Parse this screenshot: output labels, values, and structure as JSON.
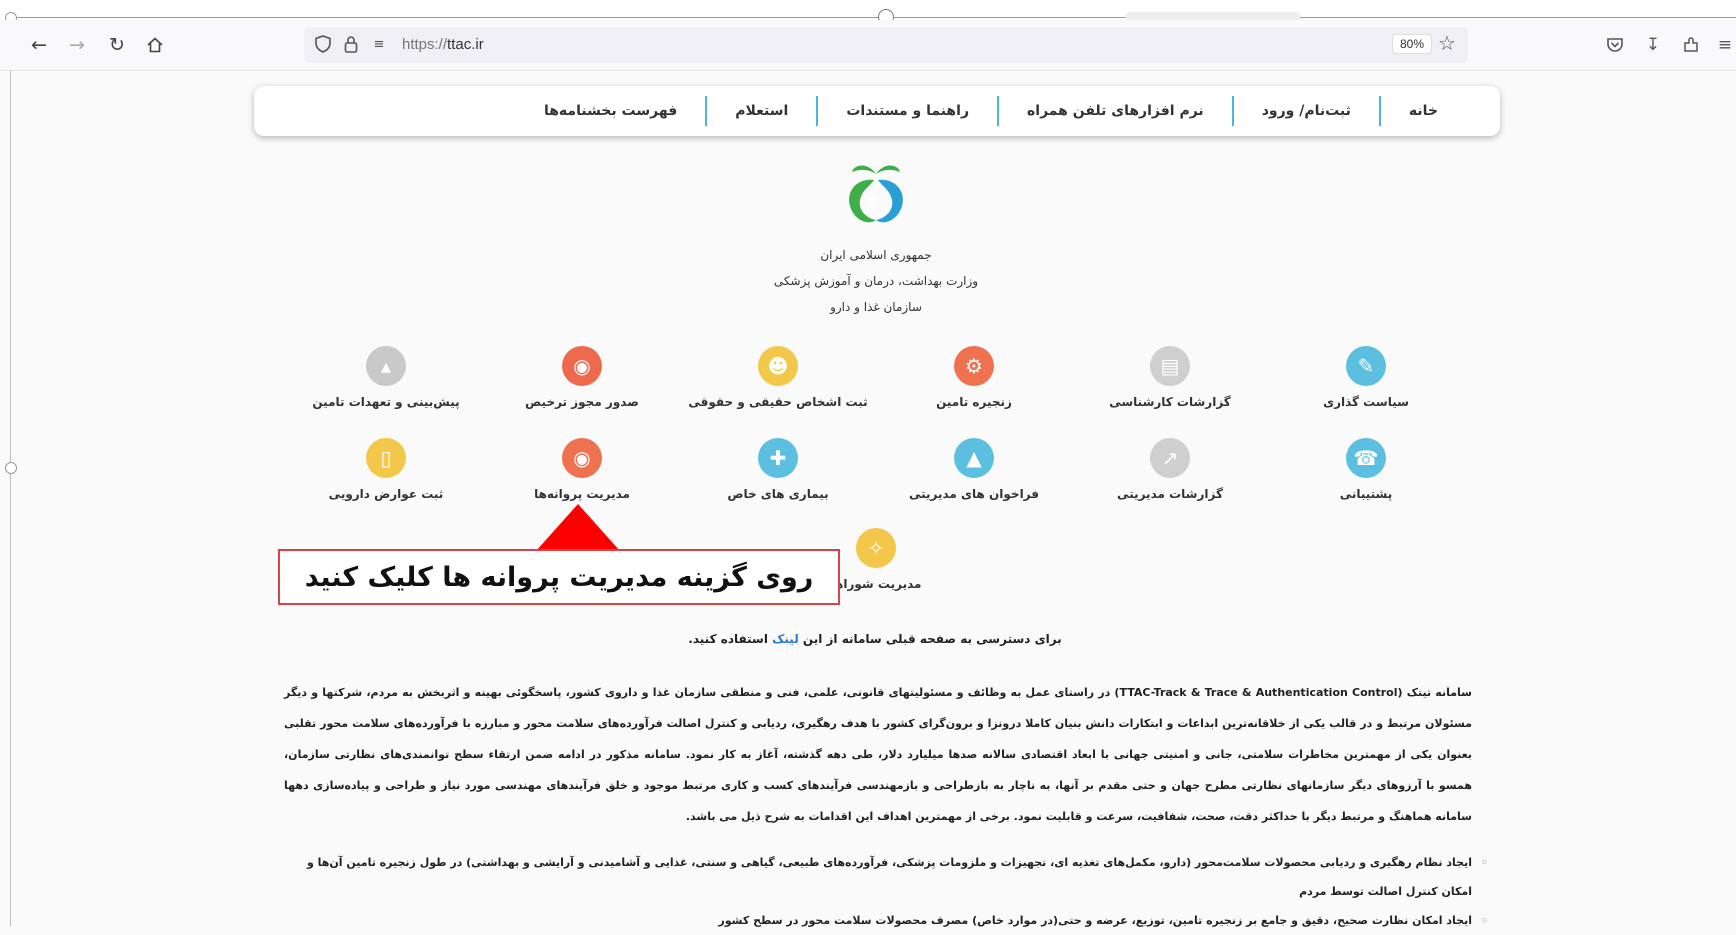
{
  "browser": {
    "url_scheme": "https://",
    "url_host": "ttac.ir",
    "zoom": "80%"
  },
  "nav": [
    "خانه",
    "ثبت‌نام/ ورود",
    "نرم افزارهای تلفن همراه",
    "راهنما و مستندات",
    "استعلام",
    "فهرست بخشنامه‌ها"
  ],
  "ministry": {
    "line1": "جمهوری اسلامی ایران",
    "line2": "وزارت بهداشت، درمان و آموزش پزشکی",
    "line3": "سازمان غذا و دارو"
  },
  "services": [
    {
      "label": "سیاست گذاری",
      "icon": "policy-document-icon",
      "color": "#5cbfe0"
    },
    {
      "label": "گزارشات کارشناسی",
      "icon": "expert-report-icon",
      "color": "#cfcfcf"
    },
    {
      "label": "زنجیره تامین",
      "icon": "supply-chain-icon",
      "color": "#ee7150"
    },
    {
      "label": "ثبت اشخاص حقیقی و حقوقی",
      "icon": "people-registration-icon",
      "color": "#f3c74a"
    },
    {
      "label": "صدور مجوز ترخیص",
      "icon": "clearance-globe-icon",
      "color": "#ee6a4f"
    },
    {
      "label": "پیش‌بینی و تعهدات تامین",
      "icon": "forecast-chart-icon",
      "color": "#c9c9c9"
    },
    {
      "label": "پشتیبانی",
      "icon": "support-icon",
      "color": "#5cbfe0"
    },
    {
      "label": "گزارشات مدیریتی",
      "icon": "management-report-icon",
      "color": "#cfcfcf"
    },
    {
      "label": "فراخوان های مدیریتی",
      "icon": "management-call-icon",
      "color": "#5cbfe0"
    },
    {
      "label": "بیماری های خاص",
      "icon": "special-disease-icon",
      "color": "#5cbfe0"
    },
    {
      "label": "مدیریت پروانه‌ها",
      "icon": "license-management-icon",
      "color": "#ee7150"
    },
    {
      "label": "ثبت عوارض دارویی",
      "icon": "drug-side-effects-icon",
      "color": "#f3c74a"
    },
    {
      "label": "مدیریت شوراها",
      "icon": "councils-management-icon",
      "color": "#f3c74a"
    }
  ],
  "callout": "روی گزینه مدیریت پروانه ها کلیک کنید",
  "access": {
    "before": "برای دسترسی به صفحه قبلی سامانه از این ",
    "link": "لینک",
    "after": " استفاده کنید."
  },
  "description": "سامانه تیتک (TTAC-Track & Trace & Authentication Control) در راستای عمل به وظائف و مسئولیتهای قانونی، علمی، فنی و منطقی سازمان غذا و داروی کشور، پاسخگوئی بهینه و اثربخش به مردم، شرکتها و دیگر مسئولان مرتبط و در قالب یکی از خلاقانه‌ترین ابداعات و ابتکارات دانش بنیان کاملا درونزا و برون‌گرای کشور با هدف رهگیری، ردیابی و کنترل اصالت فرآورده‌های سلامت محور و مبارزه با فرآورده‌های سلامت محور تقلبی بعنوان یکی از مهمترین مخاطرات سلامتی، جانی و امنیتی جهانی با ابعاد اقتصادی سالانه صدها میلیارد دلار، طی دهه گذشته، آغاز به کار نمود. سامانه مذکور در ادامه ضمن ارتقاء سطح توانمندی‌های نظارتی سازمان، همسو با آرزوهای دیگر سازمانهای نظارتی مطرح جهان و حتی مقدم بر آنها، به ناچار به بازطراحی و بازمهندسی فرآیندهای کسب و کاری مرتبط موجود و خلق فرآیندهای مهندسی مورد نیاز و طراحی و پیاده‌سازی دهها سامانه هماهنگ و مرتبط دیگر با حداکثر دقت، صحت، شفافیت، سرعت و قابلیت نمود. برخی از مهمترین اهداف این اقدامات به شرح ذیل می باشد.",
  "bullets": [
    "ایجاد نظام رهگیری و ردیابی محصولات سلامت‌محور (دارو، مکمل‌های تغذیه ای، تجهیزات و ملزومات پزشکی، فرآورده‌های طبیعی، گیاهی و سنتی، غذایی و آشامیدنی و آرایشی و بهداشتی) در طول زنجیره تامین آن‌ها و امکان کنترل اصالت توسط مردم",
    "ایجاد امکان نظارت صحیح، دقیق و جامع بر زنجیره تامین، توزیع، عرضه و حتی(در موارد خاص) مصرف محصولات سلامت محور در سطح کشور"
  ]
}
